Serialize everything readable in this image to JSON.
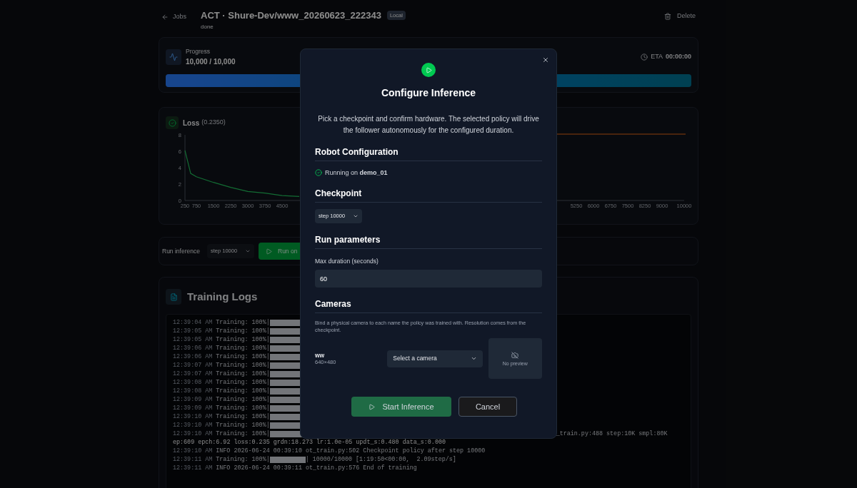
{
  "header": {
    "back_label": "Jobs",
    "title": "ACT · Shure-Dev/www_20260623_222343",
    "badge": "Local",
    "status": "done",
    "delete_label": "Delete"
  },
  "progress": {
    "label": "Progress",
    "value": "10,000 / 10,000",
    "eta_label": "ETA",
    "eta_value": "00:00:00",
    "level": 1
  },
  "loss": {
    "title": "Loss",
    "value": "(0.2350)",
    "charts": [
      {
        "chart_data": {
          "type": "line",
          "xlim": [
            250,
            10000
          ],
          "ylim": [
            0,
            8
          ],
          "yticks": [
            0,
            2,
            4,
            6,
            8
          ],
          "xticks": [
            250,
            750,
            1500,
            2250,
            3000,
            3750,
            4500
          ],
          "x": [
            250,
            500,
            750,
            1500,
            2250,
            3000,
            3750,
            4500,
            5250
          ],
          "series": [
            {
              "color": "#22c55e",
              "values": [
                6.1,
                3.3,
                2.9,
                2.2,
                1.6,
                1.1,
                0.9,
                0.6,
                0.5
              ]
            }
          ]
        }
      }
    ],
    "second_panel": {
      "axis_labels": [
        "5250",
        "6000",
        "6750",
        "7500",
        "8250",
        "9000",
        "10000"
      ]
    }
  },
  "run_inference": {
    "label": "Run inference",
    "checkpoint": "step 10000",
    "button": "Run on"
  },
  "logs": {
    "title": "Training Logs",
    "lines": [
      {
        "kind": "progress",
        "time": "12:39:04 AM",
        "text": "Training: 100%|"
      },
      {
        "kind": "progress",
        "time": "12:39:05 AM",
        "text": "Training: 100%|"
      },
      {
        "kind": "progress",
        "time": "12:39:05 AM",
        "text": "Training: 100%|"
      },
      {
        "kind": "progress",
        "time": "12:39:06 AM",
        "text": "Training: 100%|"
      },
      {
        "kind": "progress",
        "time": "12:39:06 AM",
        "text": "Training: 100%|"
      },
      {
        "kind": "progress",
        "time": "12:39:07 AM",
        "text": "Training: 100%|"
      },
      {
        "kind": "progress",
        "time": "12:39:07 AM",
        "text": "Training: 100%|"
      },
      {
        "kind": "progress",
        "time": "12:39:08 AM",
        "text": "Training: 100%|"
      },
      {
        "kind": "progress",
        "time": "12:39:08 AM",
        "text": "Training: 100%|"
      },
      {
        "kind": "progress",
        "time": "12:39:09 AM",
        "text": "Training: 100%|"
      },
      {
        "kind": "progress",
        "time": "12:39:09 AM",
        "text": "Training: 100%|"
      },
      {
        "kind": "progress",
        "time": "12:39:10 AM",
        "text": "Training: 100%|"
      },
      {
        "kind": "progress",
        "time": "12:39:10 AM",
        "text": "Training: 100%|"
      },
      {
        "kind": "progress",
        "time": "12:39:10 AM",
        "text": "Training: 100%|",
        "tail": "_train.py:488 step:10K smpl:80K"
      },
      {
        "kind": "plain",
        "text": "ep:609 epch:6.92 loss:0.235 grdn:18.273 lr:1.0e-05 updt_s:0.480 data_s:0.000"
      },
      {
        "kind": "info",
        "time": "12:39:10 AM",
        "text": "INFO 2026-06-24 00:39:10 ot_train.py:502 Checkpoint policy after step 10000"
      },
      {
        "kind": "progress",
        "time": "12:39:11 AM",
        "text": "Training: 100%|",
        "after": "| 10000/10000 [1:19:50<00:00,  2.09step/s]"
      },
      {
        "kind": "info",
        "time": "12:39:11 AM",
        "text": "INFO 2026-06-24 00:39:11 ot_train.py:576 End of training"
      }
    ]
  },
  "modal": {
    "title": "Configure Inference",
    "description": "Pick a checkpoint and confirm hardware. The selected policy will drive the follower autonomously for the configured duration.",
    "robot_heading": "Robot Configuration",
    "running_on": "Running on **demo_01**",
    "checkpoint_heading": "Checkpoint",
    "checkpoint": "step 10000",
    "params_heading": "Run parameters",
    "duration_label": "Max duration (seconds)",
    "duration_value": "60",
    "cameras_heading": "Cameras",
    "cameras_help": "Bind a physical camera to each name the policy was trained with. Resolution comes from the checkpoint.",
    "cameras": [
      {
        "name": "ww",
        "resolution": "640×480",
        "placeholder": "Select a camera",
        "preview": "No preview"
      }
    ],
    "start_button": {
      "label": "Start Inference",
      "disabled": true
    },
    "cancel_button": "Cancel"
  }
}
